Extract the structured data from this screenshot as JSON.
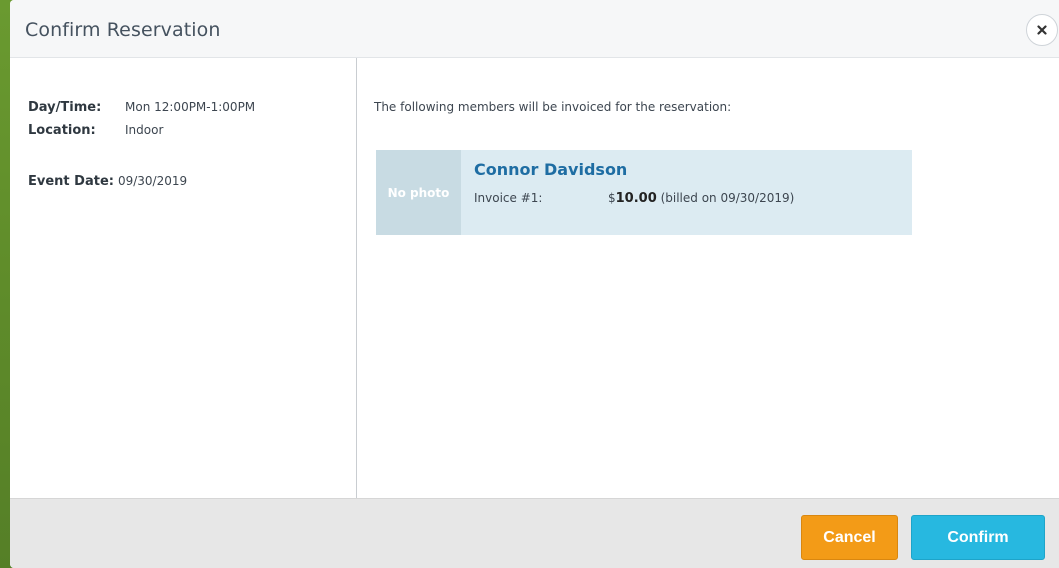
{
  "modal": {
    "title": "Confirm Reservation",
    "close_icon": "close-icon"
  },
  "details": {
    "day_time_label": "Day/Time:",
    "day_time_value": "Mon 12:00PM-1:00PM",
    "location_label": "Location:",
    "location_value": "Indoor",
    "event_date_label": "Event Date:",
    "event_date_value": "09/30/2019"
  },
  "members": {
    "intro": "The following members will be invoiced for the reservation:",
    "items": [
      {
        "photo_text": "No photo",
        "name": "Connor Davidson",
        "invoice_label": "Invoice #1:",
        "currency": "$",
        "amount": "10.00",
        "billed_note": "(billed on 09/30/2019)"
      }
    ]
  },
  "footer": {
    "cancel_label": "Cancel",
    "confirm_label": "Confirm"
  },
  "colors": {
    "background_green": "#5e8f2c",
    "member_name": "#1e6da3",
    "cancel_button": "#f39b17",
    "confirm_button": "#27b8e0",
    "card_background": "#dcebf2"
  }
}
